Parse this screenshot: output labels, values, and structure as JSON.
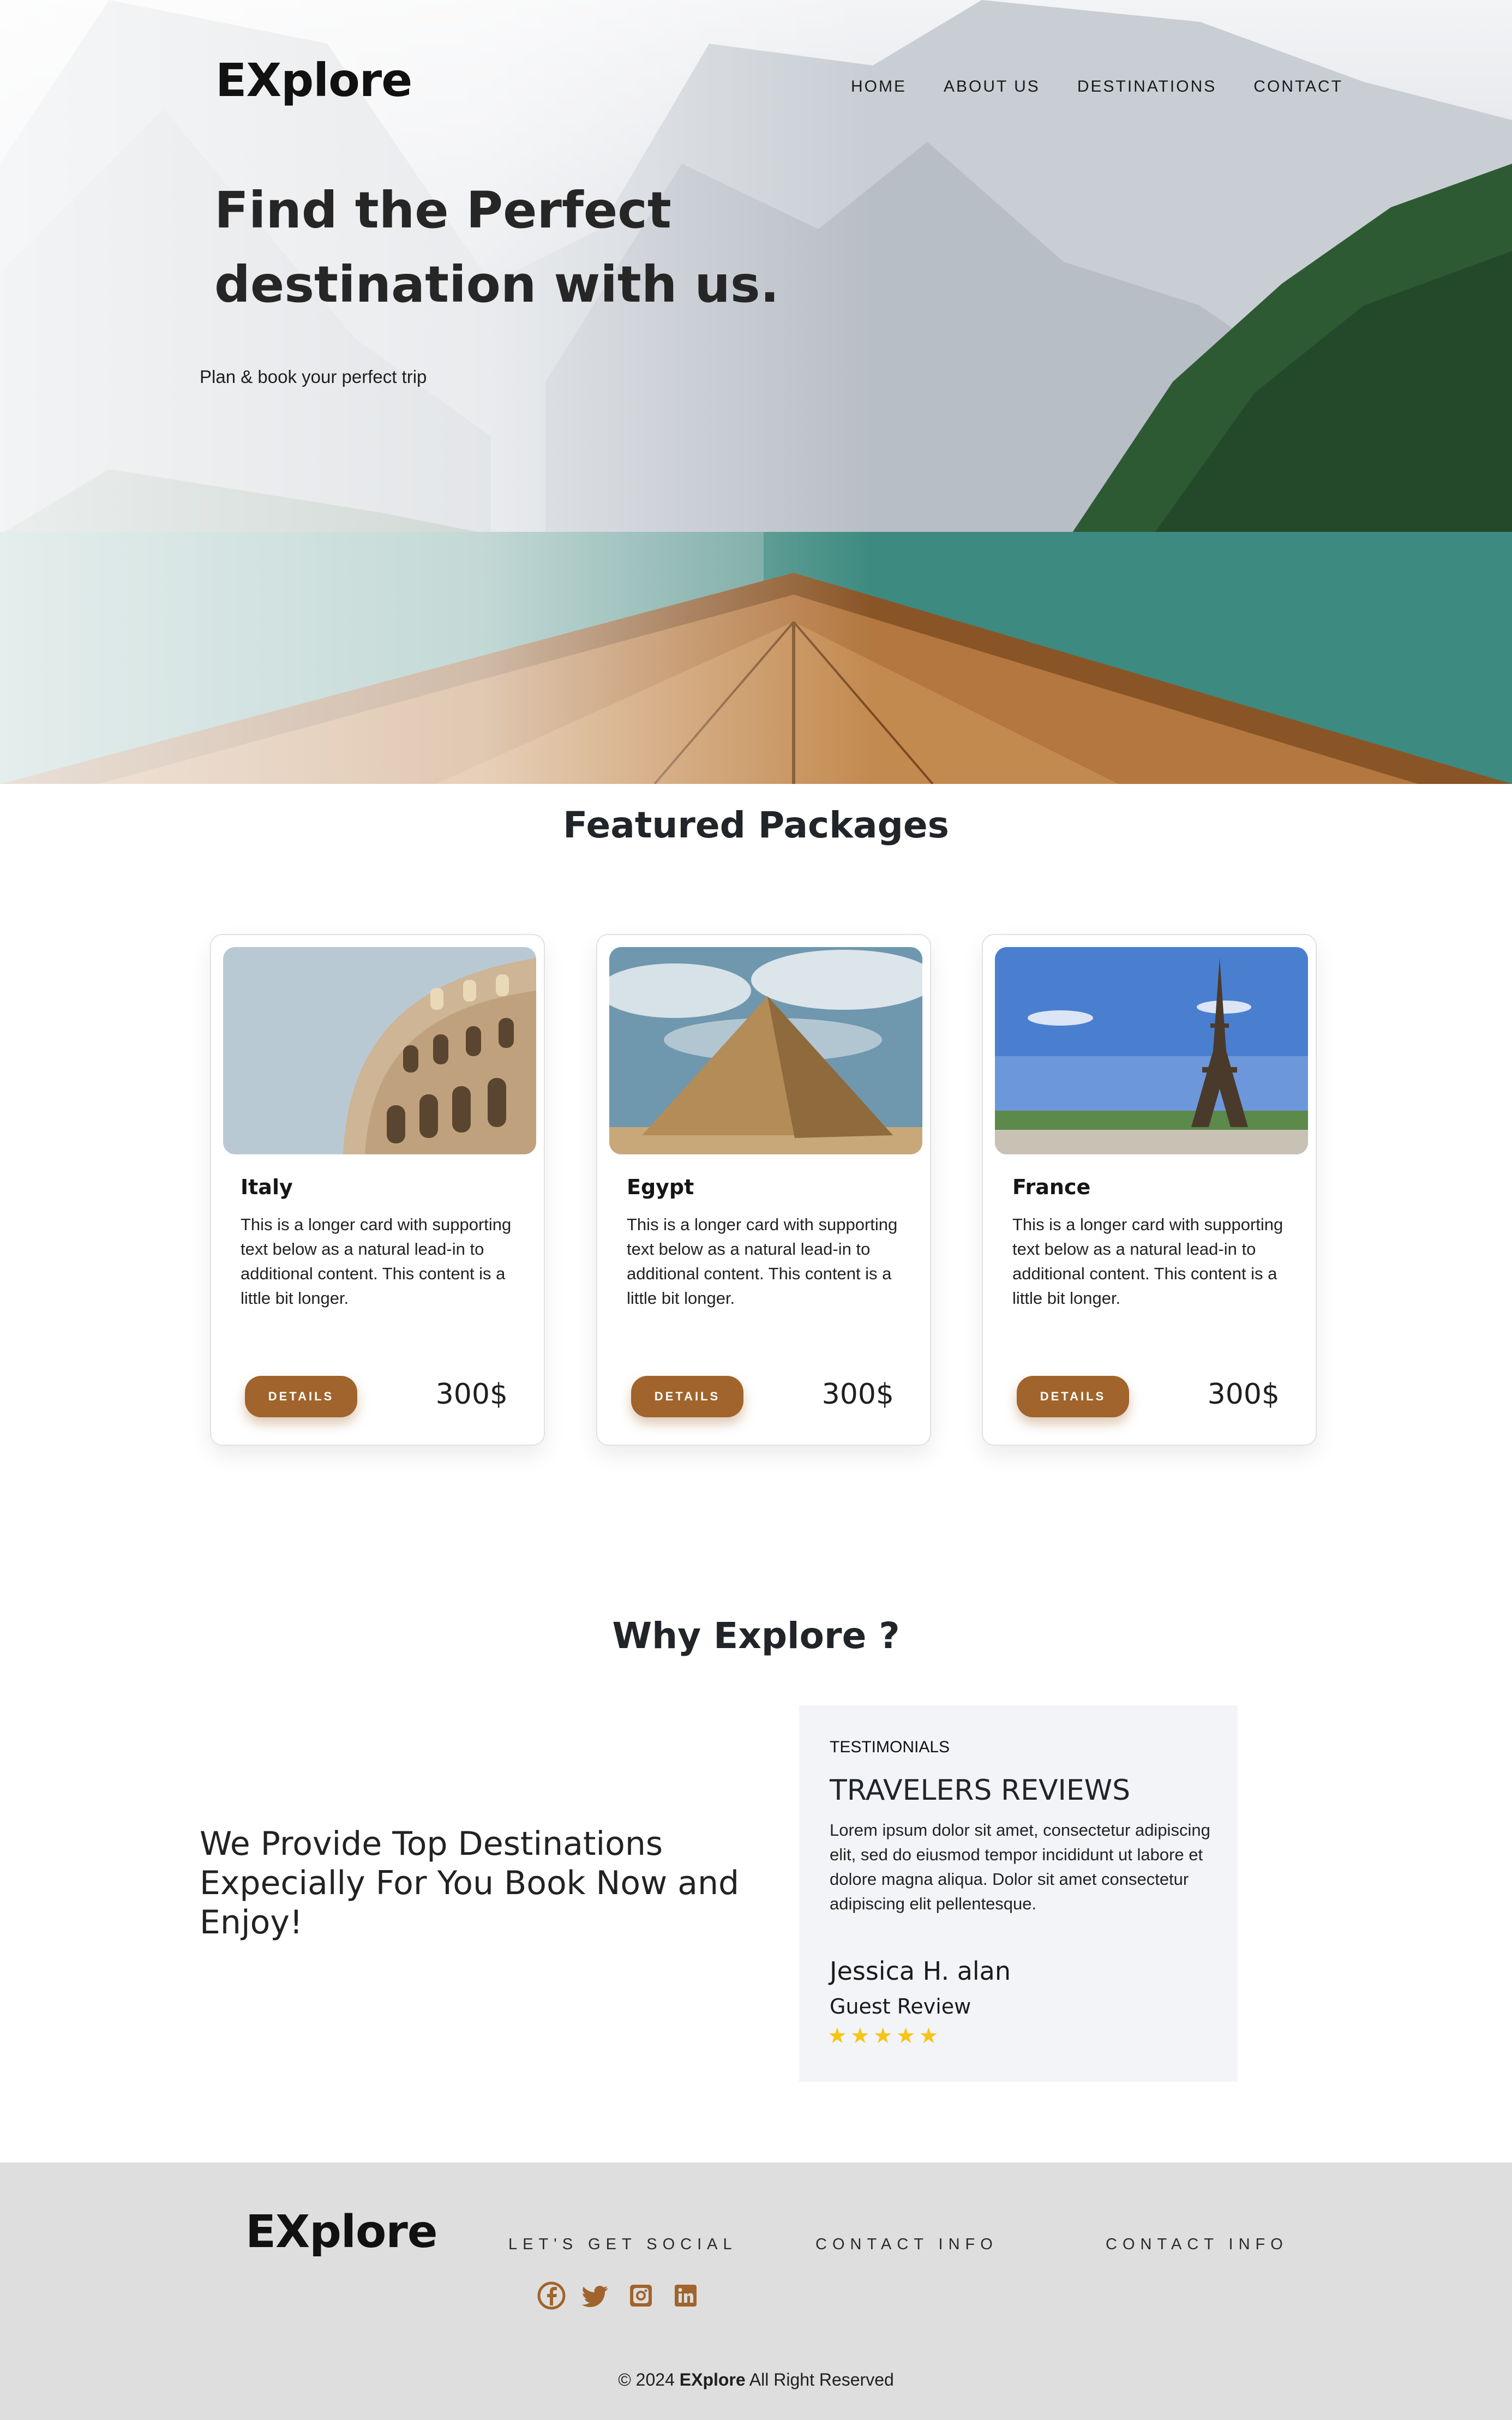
{
  "brand": "EXplore",
  "nav": [
    "HOME",
    "ABOUT US",
    "DESTINATIONS",
    "CONTACT"
  ],
  "hero": {
    "title": "Find the Perfect destination with us.",
    "subtitle": "Plan & book your perfect trip"
  },
  "featured": {
    "title": "Featured Packages",
    "cards": [
      {
        "title": "Italy",
        "text": "This is a longer card with supporting text below as a natural lead-in to additional content. This content is a little bit longer.",
        "button": "DETAILS",
        "price": "300$",
        "image_icon": "colosseum-image"
      },
      {
        "title": "Egypt",
        "text": "This is a longer card with supporting text below as a natural lead-in to additional content. This content is a little bit longer.",
        "button": "DETAILS",
        "price": "300$",
        "image_icon": "pyramid-image"
      },
      {
        "title": "France",
        "text": "This is a longer card with supporting text below as a natural lead-in to additional content. This content is a little bit longer.",
        "button": "DETAILS",
        "price": "300$",
        "image_icon": "eiffel-tower-image"
      }
    ]
  },
  "why": {
    "title": "Why Explore ?",
    "text": "We Provide Top Destinations Expecially For You Book Now and Enjoy!",
    "testimonial": {
      "tag": "TESTIMONIALS",
      "title": "TRAVELERS REVIEWS",
      "body": "Lorem ipsum dolor sit amet, consectetur adipiscing elit, sed do eiusmod tempor incididunt ut labore et dolore magna aliqua. Dolor sit amet consectetur adipiscing elit pellentesque.",
      "name": "Jessica H. alan",
      "role": "Guest Review",
      "rating": 5
    }
  },
  "footer": {
    "social_heading": "LET'S GET SOCIAL",
    "contact_heading_1": "CONTACT INFO",
    "contact_heading_2": "CONTACT INFO",
    "socials": [
      "facebook-icon",
      "twitter-icon",
      "instagram-icon",
      "linkedin-icon"
    ],
    "copyright_prefix": "© 2024",
    "copyright_brand": "EXplore",
    "copyright_suffix": "All Right Reserved"
  },
  "colors": {
    "accent": "#a0642c",
    "star": "#f5c518",
    "footer_bg": "#dedede",
    "testimonial_bg": "#f3f4f8"
  }
}
